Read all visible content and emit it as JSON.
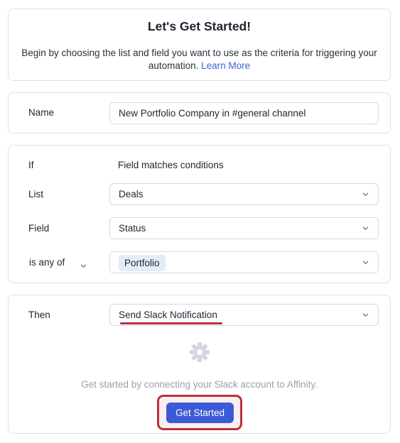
{
  "intro": {
    "title": "Let's Get Started!",
    "description": "Begin by choosing the list and field you want to use as the criteria for triggering your automation.",
    "learn_more": "Learn More"
  },
  "name_section": {
    "label": "Name",
    "value": "New Portfolio Company in #general channel"
  },
  "if_section": {
    "label": "If",
    "trigger": "Field matches conditions",
    "list_label": "List",
    "list_value": "Deals",
    "field_label": "Field",
    "field_value": "Status",
    "operator": "is any of",
    "tag_value": "Portfolio"
  },
  "then_section": {
    "label": "Then",
    "action_value": "Send Slack Notification",
    "message": "Get started by connecting your Slack account to Affinity.",
    "button_label": "Get Started"
  },
  "icons": {
    "chevron": "chevron-down-icon",
    "gear": "gear-icon"
  },
  "colors": {
    "accent": "#3b5bd6",
    "link": "#3a63d9",
    "highlight": "#b8323a",
    "tag_bg": "#e6ebf8"
  }
}
